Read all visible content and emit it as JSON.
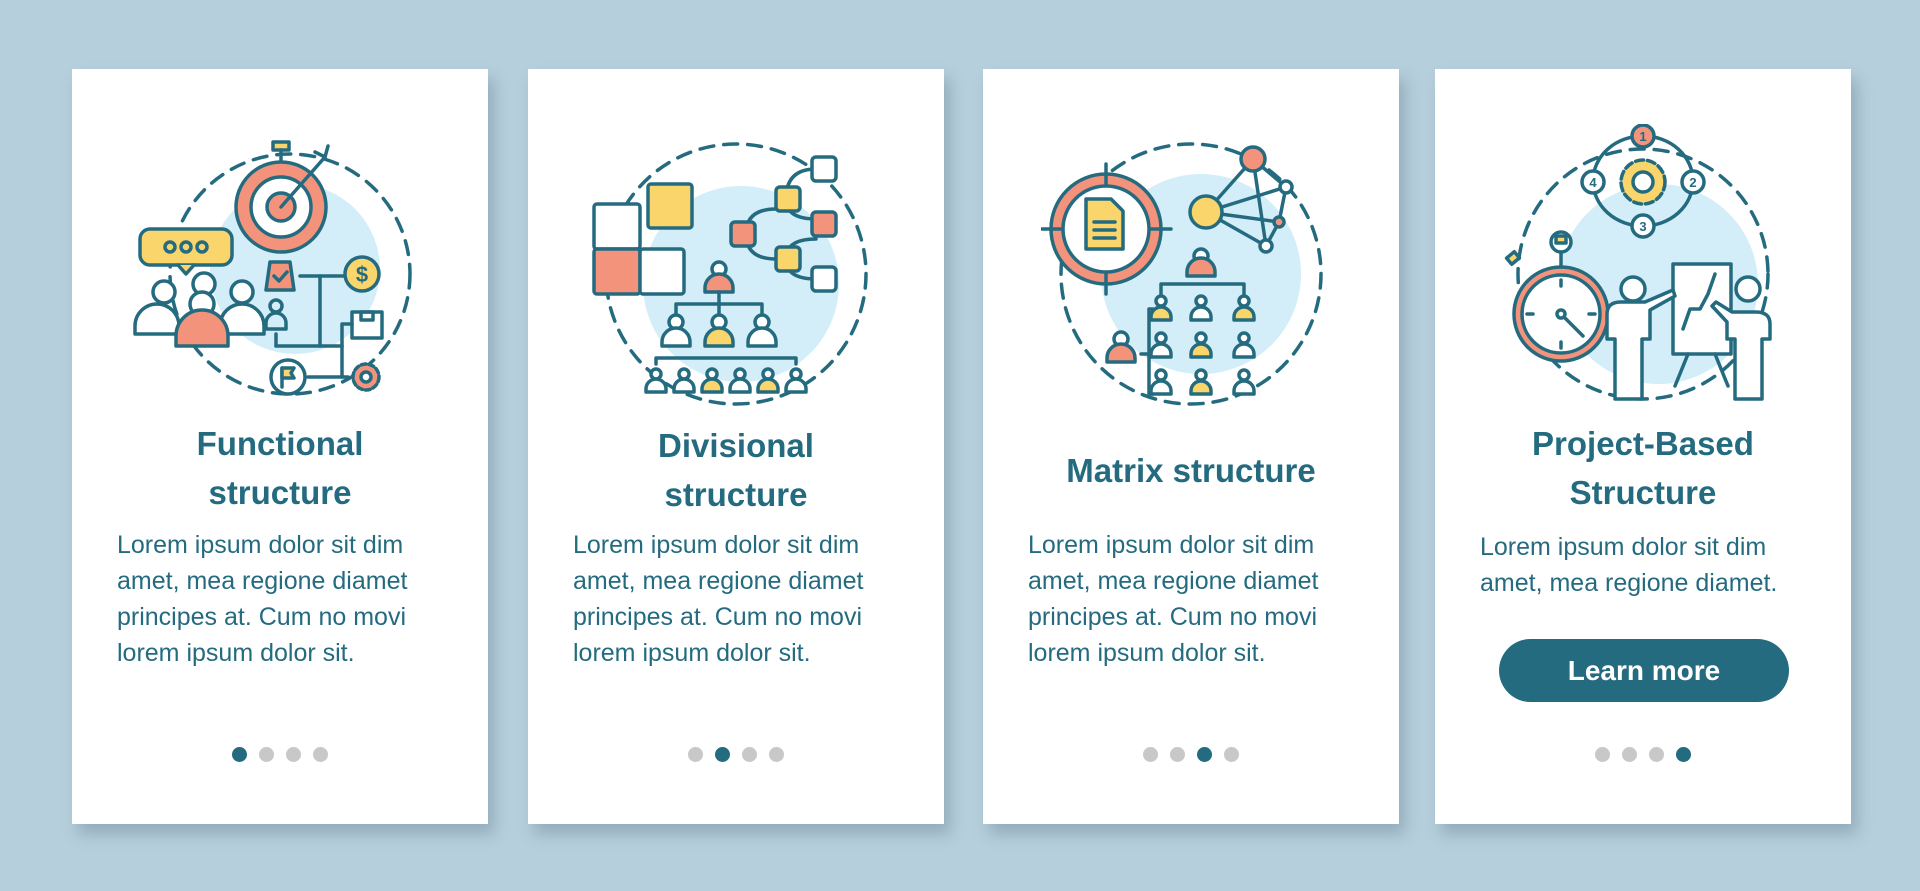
{
  "colors": {
    "background": "#b6cfdc",
    "card": "#ffffff",
    "primary": "#256b80",
    "coral": "#f4937c",
    "yellow": "#f9d56b",
    "light_blue": "#d3eef8",
    "dot_inactive": "#c8c8c8"
  },
  "cards": [
    {
      "title": "Functional structure",
      "title_lines": [
        "Functional",
        "structure"
      ],
      "body": "Lorem ipsum dolor sit dim amet, mea regione diamet principes at. Cum no movi lorem ipsum dolor sit.",
      "illustration": "functional-structure-illustration",
      "active_dot": 1
    },
    {
      "title": "Divisional structure",
      "title_lines": [
        "Divisional",
        "structure"
      ],
      "body": "Lorem ipsum dolor sit dim amet, mea regione diamet principes at. Cum no movi lorem ipsum dolor sit.",
      "illustration": "divisional-structure-illustration",
      "active_dot": 2
    },
    {
      "title": "Matrix structure",
      "title_lines": [
        "Matrix structure"
      ],
      "body": "Lorem ipsum dolor sit dim amet, mea regione diamet principes at. Cum no movi lorem ipsum dolor sit.",
      "illustration": "matrix-structure-illustration",
      "active_dot": 3
    },
    {
      "title": "Project-Based Structure",
      "title_lines": [
        "Project-Based",
        "Structure"
      ],
      "body": "Lorem ipsum dolor sit dim amet, mea regione diamet.",
      "illustration": "project-based-structure-illustration",
      "button_label": "Learn more",
      "active_dot": 4
    }
  ],
  "pagination": {
    "total": 4
  },
  "cycle_numbers": [
    "1",
    "2",
    "3",
    "4"
  ]
}
